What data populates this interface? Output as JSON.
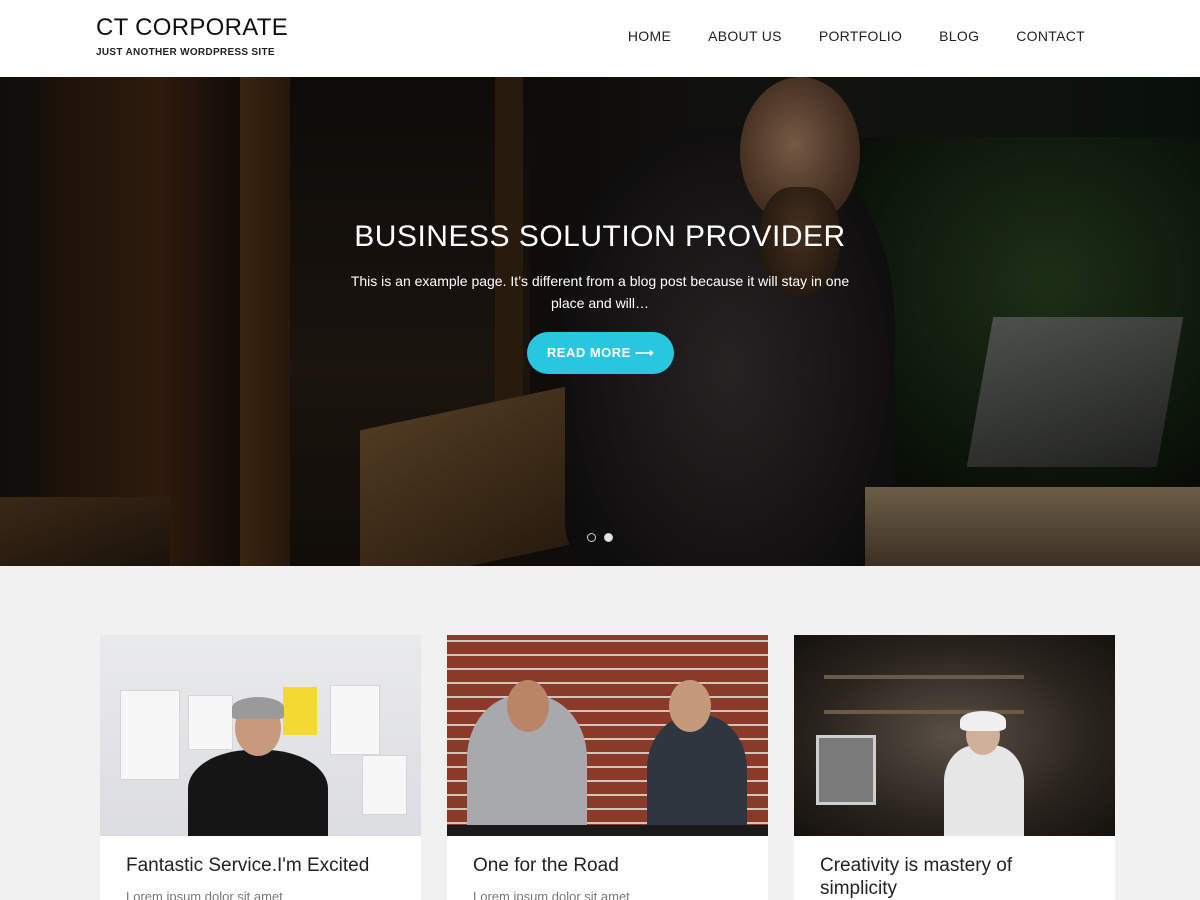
{
  "site": {
    "title": "CT CORPORATE",
    "tagline": "JUST ANOTHER WORDPRESS SITE"
  },
  "nav": {
    "items": [
      {
        "label": "HOME"
      },
      {
        "label": "ABOUT US"
      },
      {
        "label": "PORTFOLIO"
      },
      {
        "label": "BLOG"
      },
      {
        "label": "CONTACT"
      }
    ]
  },
  "hero": {
    "title": "BUSINESS SOLUTION PROVIDER",
    "text": "This is an example page. It’s different from a blog post because it will stay in one place and will…",
    "button_label": "READ MORE ⟶",
    "button_color": "#29c6e0",
    "slides": 2,
    "active_slide": 2
  },
  "cards": [
    {
      "title": "Fantastic Service.I'm Excited",
      "excerpt": "Lorem ipsum dolor sit amet"
    },
    {
      "title": "One for the Road",
      "excerpt": "Lorem ipsum dolor sit amet"
    },
    {
      "title": "Creativity is mastery of simplicity",
      "excerpt": ""
    }
  ]
}
